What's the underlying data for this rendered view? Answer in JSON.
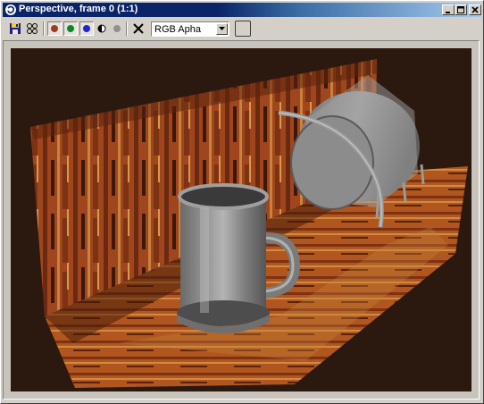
{
  "window": {
    "title": "Perspective, frame 0 (1:1)",
    "title_icon": "3ds-max-logo-icon",
    "controls": [
      "minimize-icon",
      "maximize-icon",
      "close-icon"
    ]
  },
  "toolbar": {
    "buttons": [
      {
        "name": "save-image",
        "icon": "floppy-disk-icon"
      },
      {
        "name": "clone-window",
        "icon": "clone-icon"
      },
      {
        "name": "red-channel",
        "color": "#a03c1e"
      },
      {
        "name": "green-channel",
        "color": "#0a8a1e"
      },
      {
        "name": "blue-channel",
        "color": "#1e28c8"
      },
      {
        "name": "monochrome",
        "icon": "half-circle-icon"
      },
      {
        "name": "alpha-channel",
        "color": "#909090"
      },
      {
        "name": "clear",
        "icon": "x-icon"
      }
    ],
    "channel_select": {
      "value": "RGB Apha"
    },
    "color_swatch": {
      "color": "#d4d0c8"
    }
  },
  "colors": {
    "titlebar_active": "#0a246a",
    "viewport_background": "#2b190f",
    "wood_dark": "#6b2a10",
    "wood_mid": "#a0461e",
    "wood_light": "#c8823c",
    "metal": "#8a8a8a"
  },
  "viewport": {
    "scene_objects": [
      "wooden-backdrop",
      "wooden-floor",
      "metal-mug",
      "tilted-drum",
      "metal-pipe"
    ]
  }
}
